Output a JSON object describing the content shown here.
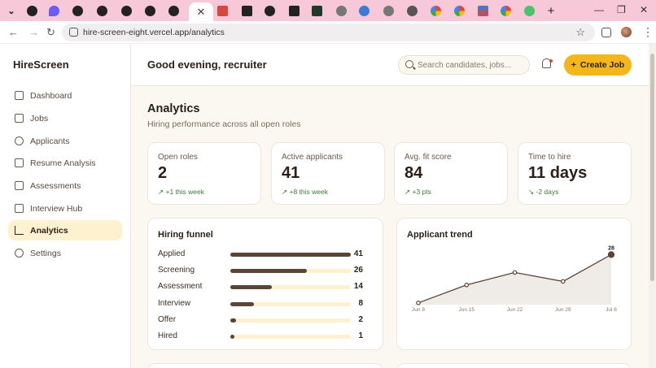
{
  "browser": {
    "url": "hire-screen-eight.vercel.app/analytics",
    "active_tab_close": "✕",
    "new_tab": "+"
  },
  "brand": "HireScreen",
  "nav": [
    {
      "label": "Dashboard",
      "icon": "dashboard-icon"
    },
    {
      "label": "Jobs",
      "icon": "briefcase-icon"
    },
    {
      "label": "Applicants",
      "icon": "users-icon"
    },
    {
      "label": "Resume Analysis",
      "icon": "file-icon"
    },
    {
      "label": "Assessments",
      "icon": "clipboard-icon"
    },
    {
      "label": "Interview Hub",
      "icon": "video-icon"
    },
    {
      "label": "Analytics",
      "icon": "chart-icon",
      "active": true
    },
    {
      "label": "Settings",
      "icon": "gear-icon"
    }
  ],
  "topbar": {
    "greeting": "Good evening, recruiter",
    "search_placeholder": "Search candidates, jobs...",
    "create_label": "Create Job",
    "create_icon": "+"
  },
  "page": {
    "title": "Analytics",
    "subtitle": "Hiring performance across all open roles"
  },
  "stats": [
    {
      "label": "Open roles",
      "value": "2",
      "change": "↗ +1 this week"
    },
    {
      "label": "Active applicants",
      "value": "41",
      "change": "↗ +8 this week"
    },
    {
      "label": "Avg. fit score",
      "value": "84",
      "change": "↗ +3 pts"
    },
    {
      "label": "Time to hire",
      "value": "11 days",
      "change": "↘ -2 days"
    }
  ],
  "funnel": {
    "title": "Hiring funnel",
    "max": 41,
    "rows": [
      {
        "label": "Applied",
        "value": 41
      },
      {
        "label": "Screening",
        "value": 26
      },
      {
        "label": "Assessment",
        "value": 14
      },
      {
        "label": "Interview",
        "value": 8
      },
      {
        "label": "Offer",
        "value": 2
      },
      {
        "label": "Hired",
        "value": 1
      }
    ]
  },
  "colors": {
    "accent": "#f4b61a",
    "bar": "#5b4336",
    "track": "#fdf1cf",
    "positive": "#3f7a3a"
  },
  "chart_data": {
    "type": "area",
    "title": "Applicant trend",
    "categories": [
      "Jun 8",
      "Jun 15",
      "Jun 22",
      "Jun 29",
      "Jul 6"
    ],
    "series": [
      {
        "values": [
          1,
          11,
          18,
          13,
          28
        ]
      }
    ],
    "last_label": "28",
    "ylim": [
      0,
      30
    ],
    "grid": false
  }
}
